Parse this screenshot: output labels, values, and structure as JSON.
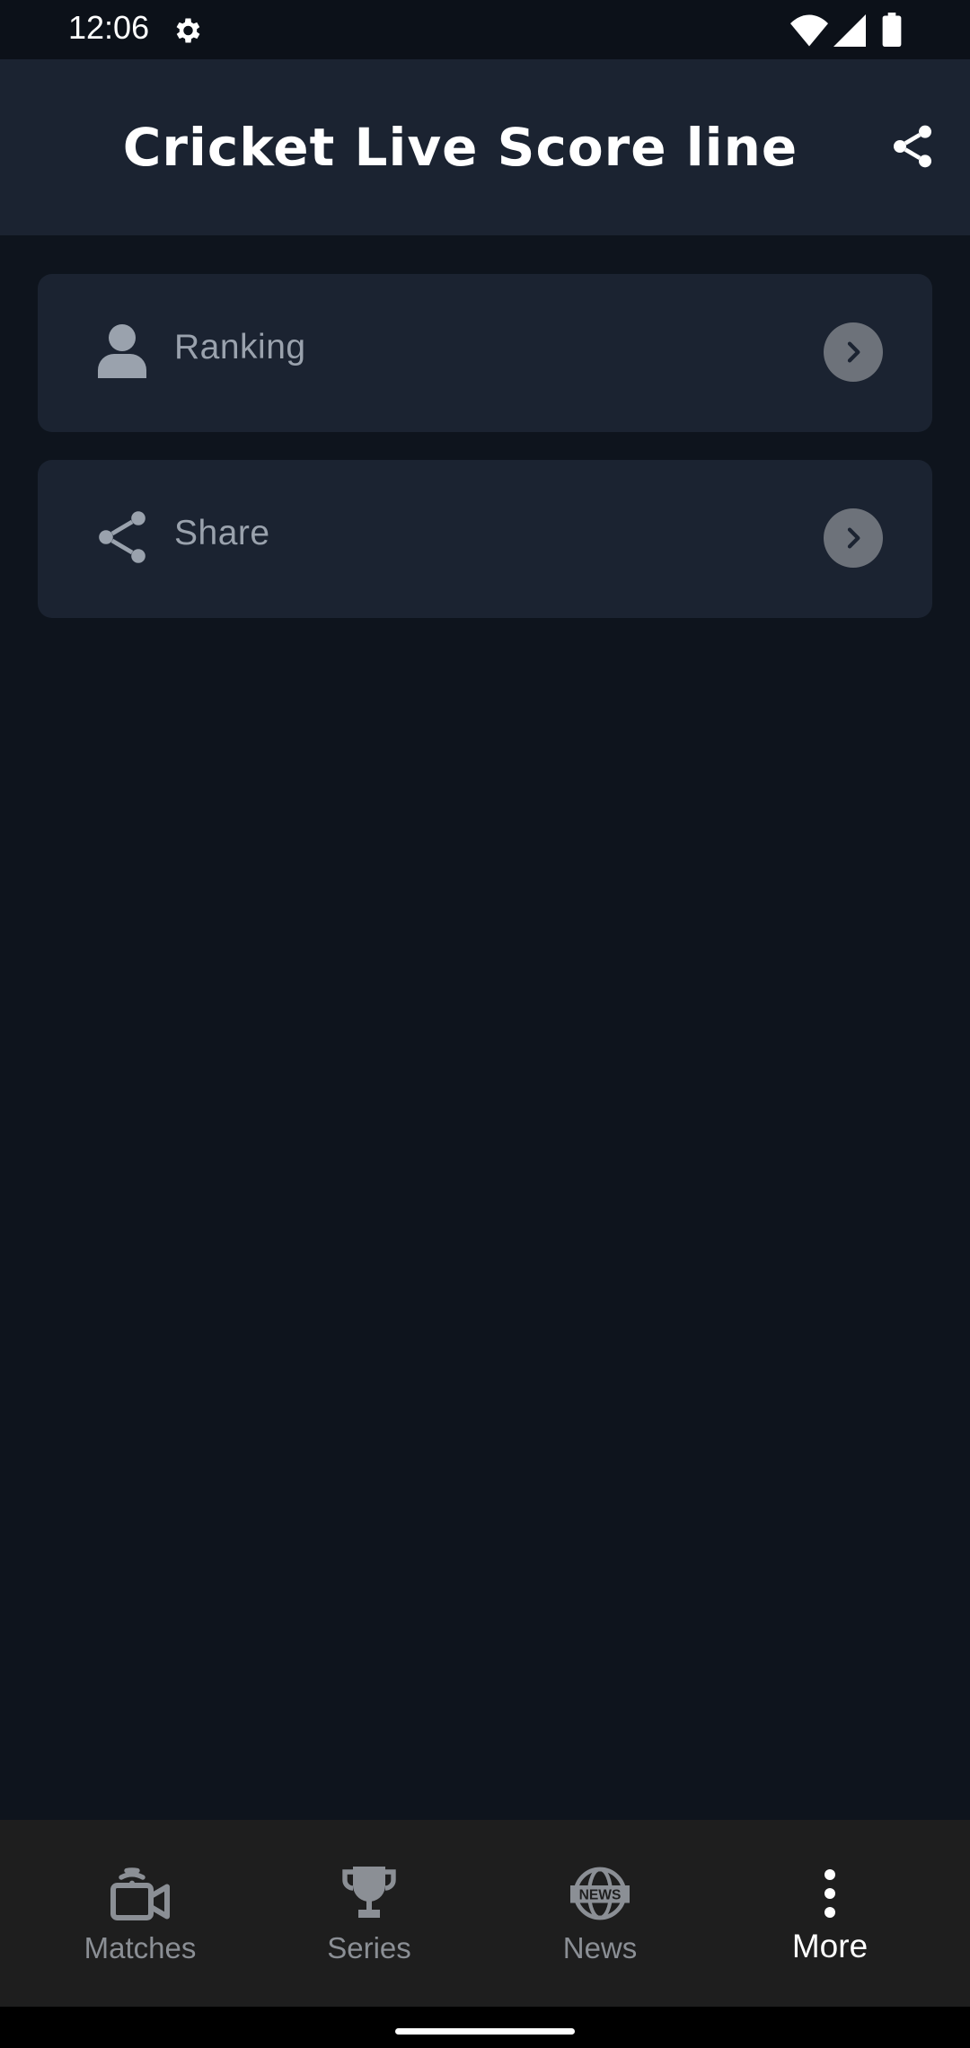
{
  "status_bar": {
    "time": "12:06",
    "icons": [
      "gear-icon",
      "wifi-icon",
      "signal-icon",
      "battery-icon"
    ]
  },
  "app_bar": {
    "title": "Cricket Live Score line",
    "share_icon": "share-icon"
  },
  "menu": {
    "items": [
      {
        "label": "Ranking",
        "icon": "person-icon"
      },
      {
        "label": "Share",
        "icon": "share-icon"
      }
    ]
  },
  "bottom_nav": {
    "items": [
      {
        "label": "Matches",
        "icon": "live-tv-icon",
        "active": false
      },
      {
        "label": "Series",
        "icon": "trophy-icon",
        "active": false
      },
      {
        "label": "News",
        "icon": "news-globe-icon",
        "active": false
      },
      {
        "label": "More",
        "icon": "more-vert-icon",
        "active": true
      }
    ]
  },
  "colors": {
    "background": "#0e141d",
    "card": "#1b2331",
    "nav_background": "#1e1e1e",
    "inactive": "#8b8f95",
    "active": "#ffffff"
  }
}
